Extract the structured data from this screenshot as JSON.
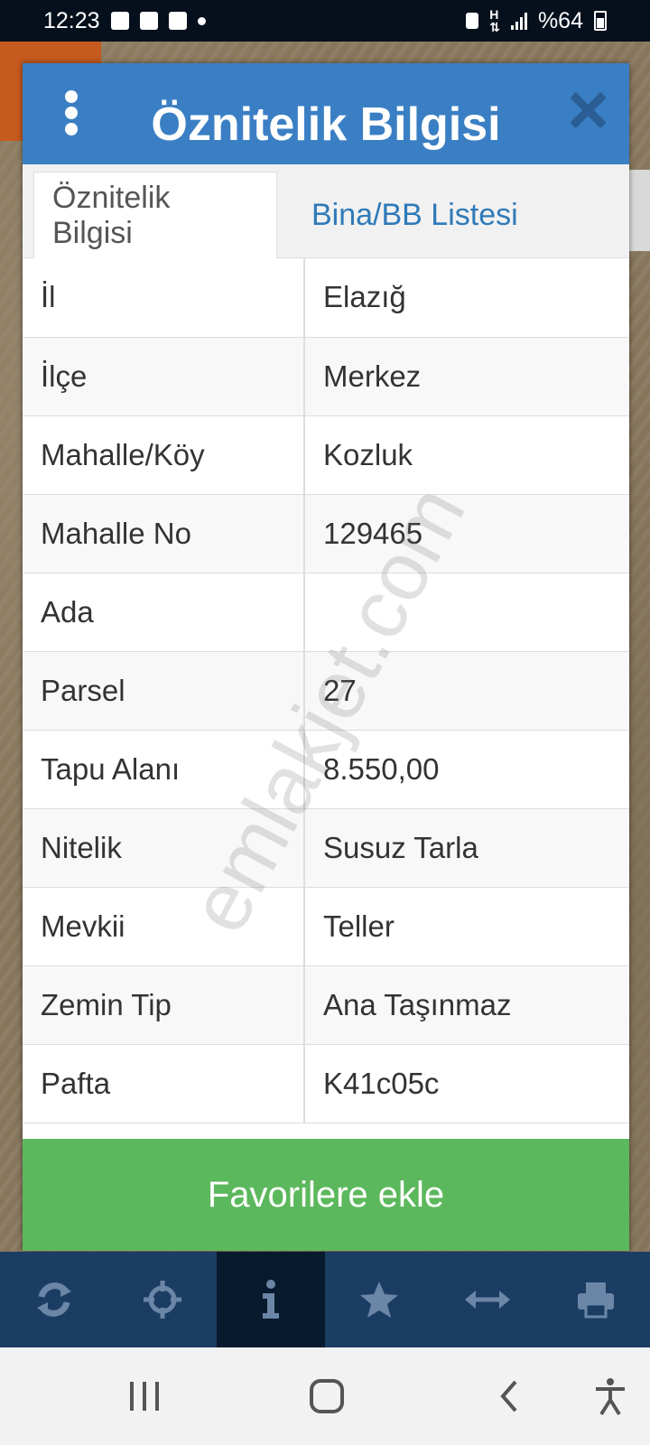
{
  "status_bar": {
    "time": "12:23",
    "battery_percent": "%64",
    "icons": [
      "gallery-icon",
      "facebook-icon",
      "facebook-icon",
      "notification-dot",
      "recycle-icon",
      "network-icon",
      "signal-icon",
      "battery-icon"
    ]
  },
  "dialog": {
    "title": "Öznitelik Bilgisi",
    "tabs": [
      {
        "label": "Öznitelik Bilgisi",
        "active": true
      },
      {
        "label": "Bina/BB Listesi",
        "active": false
      }
    ],
    "rows": [
      {
        "key": "İl",
        "value": "Elazığ"
      },
      {
        "key": "İlçe",
        "value": "Merkez"
      },
      {
        "key": "Mahalle/Köy",
        "value": "Kozluk"
      },
      {
        "key": "Mahalle No",
        "value": "129465"
      },
      {
        "key": "Ada",
        "value": ""
      },
      {
        "key": "Parsel",
        "value": "27"
      },
      {
        "key": "Tapu Alanı",
        "value": "8.550,00"
      },
      {
        "key": "Nitelik",
        "value": "Susuz Tarla"
      },
      {
        "key": "Mevkii",
        "value": "Teller"
      },
      {
        "key": "Zemin Tip",
        "value": "Ana Taşınmaz"
      },
      {
        "key": "Pafta",
        "value": "K41c05c"
      }
    ],
    "favorite_button": "Favorilere ekle"
  },
  "watermark": "emlakjet.com",
  "toolbar": {
    "items": [
      "refresh-icon",
      "crosshair-icon",
      "info-icon",
      "star-icon",
      "measure-icon",
      "print-icon"
    ],
    "active_index": 2
  },
  "colors": {
    "header": "#3a7fc4",
    "button": "#5cb85c",
    "toolbar": "#1c3d63",
    "tab_text": "#2f7ab9"
  }
}
